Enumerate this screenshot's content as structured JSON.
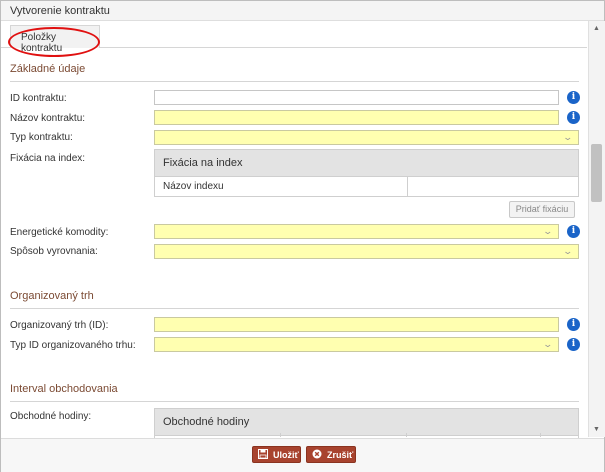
{
  "window": {
    "title": "Vytvorenie kontraktu"
  },
  "tabs": [
    {
      "label": "Položky kontraktu"
    }
  ],
  "sections": {
    "basic": {
      "title": "Základné údaje",
      "contract_id_label": "ID kontraktu:",
      "contract_name_label": "Názov kontraktu:",
      "contract_type_label": "Typ kontraktu:",
      "index_fixing_label": "Fixácia na index:",
      "index_table": {
        "header": "Fixácia na index",
        "col_index_name": "Názov indexu"
      },
      "add_fixing_button": "Pridať fixáciu",
      "energy_commodities_label": "Energetické komodity:",
      "settlement_method_label": "Spôsob vyrovnania:"
    },
    "organized_market": {
      "title": "Organizovaný trh",
      "market_id_label": "Organizovaný trh (ID):",
      "market_id_type_label": "Typ ID organizovaného trhu:"
    },
    "trading_interval": {
      "title": "Interval obchodovania",
      "trading_hours_label": "Obchodné hodiny:",
      "trading_hours_table": {
        "header": "Obchodné hodiny"
      }
    }
  },
  "footer": {
    "save_label": "Uložiť",
    "cancel_label": "Zrušiť"
  },
  "colors": {
    "accent": "#a8432e",
    "section_title": "#7b4a33",
    "required_field": "#ffffb0",
    "info_icon": "#1a64c8",
    "highlight_ring": "#e01010"
  },
  "icons": {
    "info": "info-icon",
    "dropdown": "chevron-down-icon",
    "save": "floppy-icon",
    "cancel": "close-circle-icon"
  }
}
